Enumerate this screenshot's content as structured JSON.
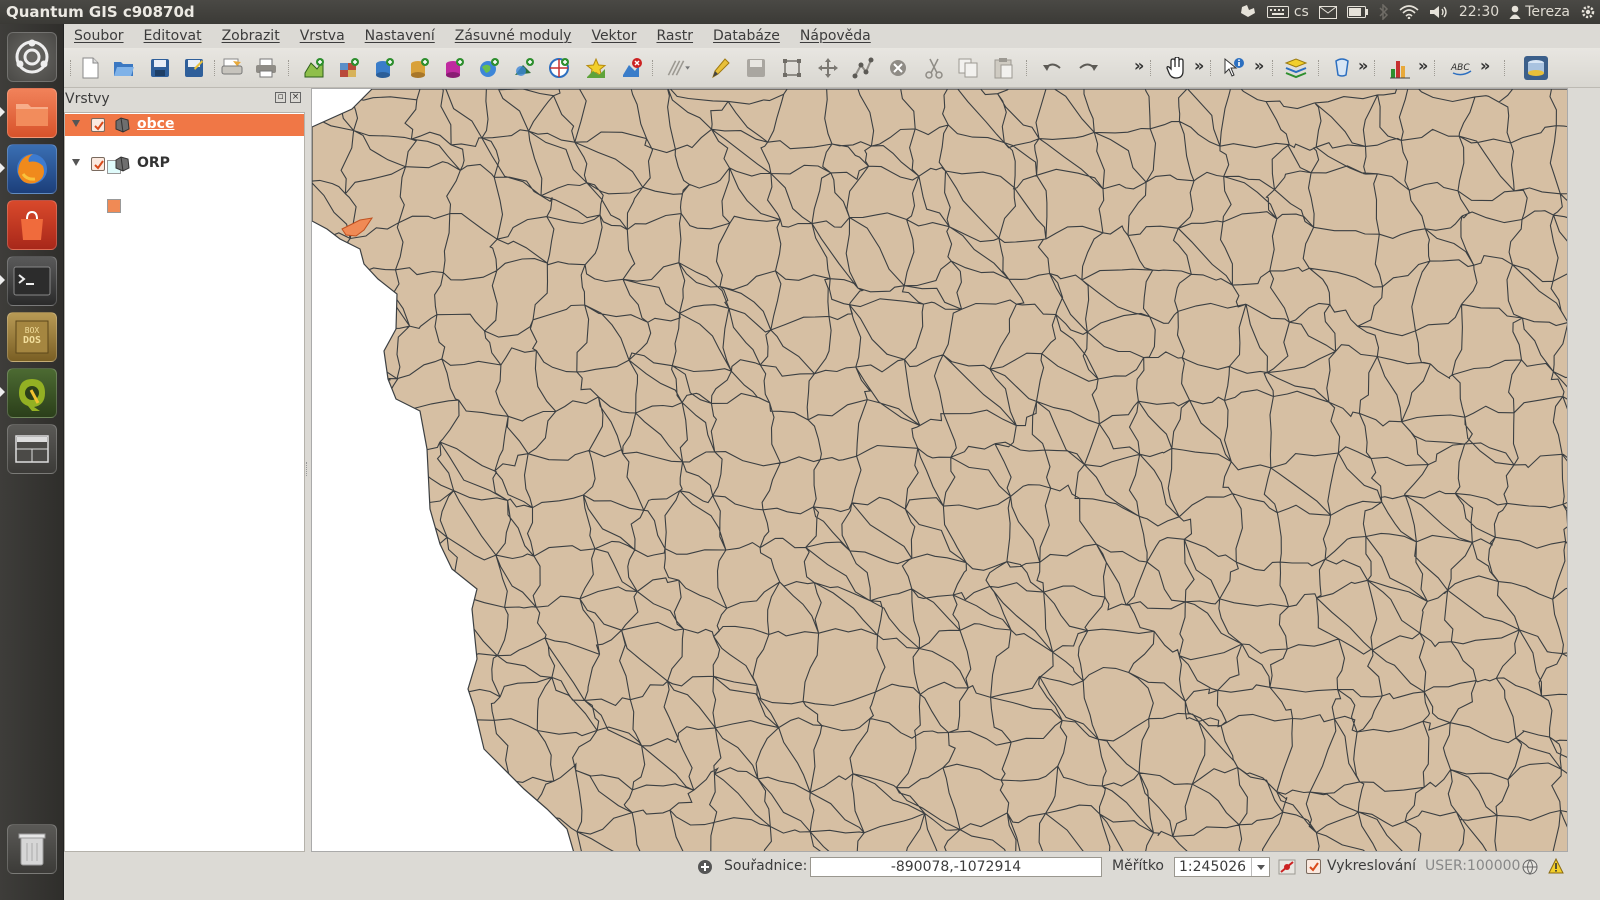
{
  "window": {
    "title": "Quantum GIS c90870d"
  },
  "indicators": {
    "keyboard_layout": "cs",
    "time": "22:30",
    "user": "Tereza"
  },
  "launcher": {
    "items": [
      {
        "name": "dash-home"
      },
      {
        "name": "files"
      },
      {
        "name": "firefox"
      },
      {
        "name": "software-center"
      },
      {
        "name": "terminal"
      },
      {
        "name": "dosbox"
      },
      {
        "name": "qgis"
      },
      {
        "name": "workspace-switcher"
      },
      {
        "name": "trash"
      }
    ]
  },
  "menu": {
    "items": [
      "Soubor",
      "Editovat",
      "Zobrazit",
      "Vrstva",
      "Nastavení",
      "Zásuvné moduly",
      "Vektor",
      "Rastr",
      "Databáze",
      "Nápověda"
    ]
  },
  "toolbar": {
    "overflow_label": "»"
  },
  "layers_panel": {
    "title": "Vrstvy",
    "layers": [
      {
        "name": "obce",
        "checked": true,
        "selected": true,
        "symbol_color": "#e0fbfb"
      },
      {
        "name": "ORP",
        "checked": true,
        "selected": false,
        "symbol_color": "#f08a55"
      }
    ]
  },
  "map": {
    "fill_color": "#d6bfa3",
    "boundary_color": "#3b3f42",
    "highlight_color": "#f08a55",
    "background_color": "#ffffff"
  },
  "statusbar": {
    "coord_label": "Souřadnice:",
    "coord_value": "-890078,-1072914",
    "scale_label": "Měřítko",
    "scale_value": "1:245026",
    "render_label": "Vykreslování",
    "render_checked": true,
    "crs": "USER:100000"
  }
}
